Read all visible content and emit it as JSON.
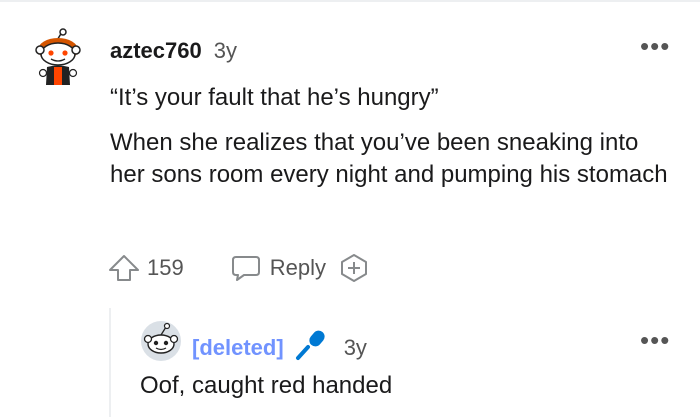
{
  "comment": {
    "username": "aztec760",
    "age": "3y",
    "quote": "“It’s your fault that he’s hungry”",
    "body": "When she realizes that you’ve been sneaking into her sons room every night and pumping his stomach",
    "votes": "159",
    "reply_label": "Reply",
    "more_label": "•••"
  },
  "reply": {
    "username": "[deleted]",
    "age": "3y",
    "body": "Oof, caught red handed",
    "more_label": "•••"
  },
  "colors": {
    "deleted_user": "#7193ff",
    "mic_icon": "#0079d3",
    "muted_text": "#555555",
    "thread_line": "#edeff1"
  },
  "icons": [
    "snoo-avatar-icon",
    "upvote-arrow-icon",
    "comment-bubble-icon",
    "add-award-icon",
    "microphone-icon",
    "more-options-icon"
  ]
}
